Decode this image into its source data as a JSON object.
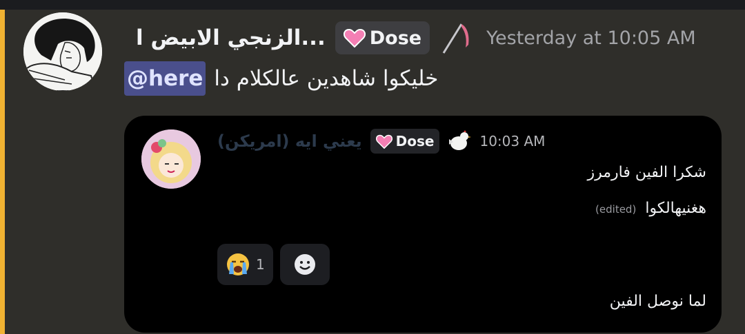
{
  "message": {
    "username": "الزنجي الابيض ا...",
    "tag": "Dose",
    "timestamp": "Yesterday at 10:05 AM",
    "mention": "@here",
    "text": "خليكوا شاهدين عالكلام دا"
  },
  "embed": {
    "username": "يعني ايه (امريكن)",
    "tag": "Dose",
    "timestamp": "10:03 AM",
    "lines": [
      "شكرا الفين فارمرز",
      "هغنيهالكوا",
      "لما نوصل الفين"
    ],
    "edited_label": "(edited)",
    "reactions": [
      {
        "emoji": "loudly-crying-face",
        "count": "1"
      },
      {
        "emoji": "add-reaction-smiley",
        "count": ""
      }
    ]
  },
  "colors": {
    "highlight": "#f0b232",
    "mention_bg": "#4a4f8c",
    "tag_heart": "#f47fb4"
  }
}
